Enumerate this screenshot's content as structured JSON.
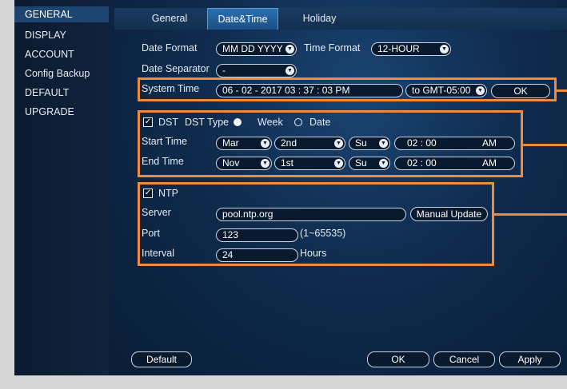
{
  "sidebar": {
    "items": [
      {
        "label": "GENERAL"
      },
      {
        "label": "DISPLAY"
      },
      {
        "label": "ACCOUNT"
      },
      {
        "label": "Config Backup"
      },
      {
        "label": "DEFAULT"
      },
      {
        "label": "UPGRADE"
      }
    ]
  },
  "tabs": [
    {
      "label": "General"
    },
    {
      "label": "Date&Time"
    },
    {
      "label": "Holiday"
    }
  ],
  "date": {
    "format_label": "Date Format",
    "format_value": "MM DD YYYY",
    "time_format_label": "Time Format",
    "time_format_value": "12-HOUR",
    "separator_label": "Date Separator",
    "separator_value": "-"
  },
  "system_time": {
    "label": "System Time",
    "value": "06 - 02 -  2017    03 : 37 : 03  PM",
    "timezone": "to GMT-05:00",
    "ok_label": "OK"
  },
  "dst": {
    "label": "DST",
    "type_label": "DST Type",
    "option_week": "Week",
    "option_date": "Date",
    "start_label": "Start Time",
    "start_month": "Mar",
    "start_week": "2nd",
    "start_day": "Su",
    "start_time": "02  :  00",
    "start_ampm": "AM",
    "end_label": "End Time",
    "end_month": "Nov",
    "end_week": "1st",
    "end_day": "Su",
    "end_time": "02  :  00",
    "end_ampm": "AM"
  },
  "ntp": {
    "label": "NTP",
    "server_label": "Server",
    "server_value": "pool.ntp.org",
    "manual_update_label": "Manual Update",
    "port_label": "Port",
    "port_value": "123",
    "port_range": "(1~65535)",
    "interval_label": "Interval",
    "interval_value": "24",
    "interval_unit": "Hours"
  },
  "footer": {
    "default_label": "Default",
    "ok_label": "OK",
    "cancel_label": "Cancel",
    "apply_label": "Apply"
  },
  "colors": {
    "highlight": "#f08a3c",
    "panel": "#0f2b4d",
    "active_tab": "#2a6fb0"
  }
}
